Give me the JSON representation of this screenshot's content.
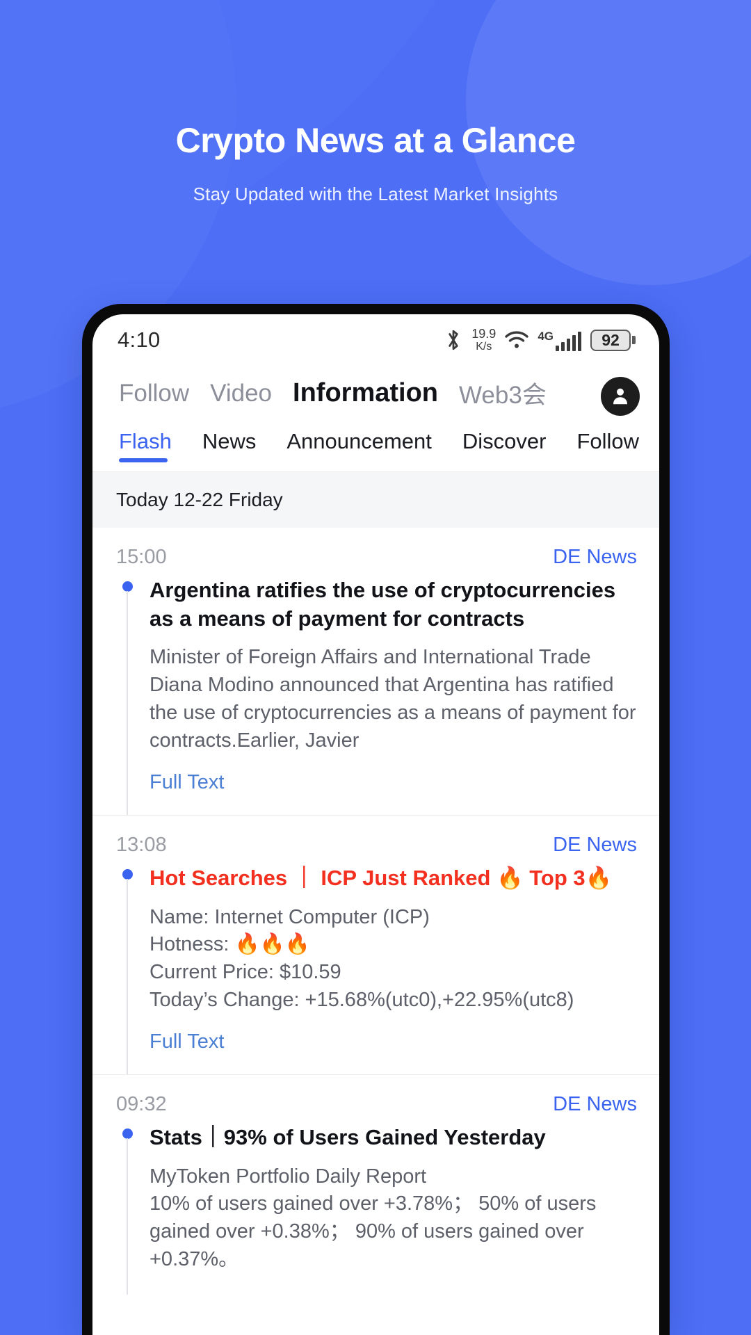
{
  "hero": {
    "title": "Crypto News at a Glance",
    "subtitle": "Stay Updated with the Latest Market Insights"
  },
  "colors": {
    "background": "#4d6ef5",
    "accent": "#3a63f0",
    "hot": "#f3301f",
    "link": "#4a7fd4"
  },
  "status_bar": {
    "time": "4:10",
    "net_speed_value": "19.9",
    "net_speed_unit": "K/s",
    "network_type": "4G",
    "battery_level": "92"
  },
  "top_nav": {
    "items": [
      {
        "label": "Follow",
        "active": false
      },
      {
        "label": "Video",
        "active": false
      },
      {
        "label": "Information",
        "active": true
      },
      {
        "label": "Web3会",
        "active": false
      }
    ]
  },
  "sub_tabs": {
    "items": [
      {
        "label": "Flash",
        "active": true
      },
      {
        "label": "News",
        "active": false
      },
      {
        "label": "Announcement",
        "active": false
      },
      {
        "label": "Discover",
        "active": false
      },
      {
        "label": "Follow",
        "active": false
      }
    ]
  },
  "date_header": "Today 12-22 Friday",
  "feed": {
    "full_text_label": "Full Text",
    "items": [
      {
        "time": "15:00",
        "source": "DE News",
        "title": "Argentina ratifies the use of cryptocurrencies as a means of payment for contracts",
        "hot": false,
        "body": "Minister of Foreign Affairs and International Trade Diana Modino announced that Argentina has ratified the use of cryptocurrencies as a means of payment for contracts.Earlier, Javier"
      },
      {
        "time": "13:08",
        "source": "DE News",
        "title": "Hot Searches ｜ ICP Just Ranked 🔥 Top 3🔥",
        "hot": true,
        "body": "Name: Internet Computer (ICP)\nHotness: 🔥🔥🔥\nCurrent Price: $10.59\nToday’s Change: +15.68%(utc0),+22.95%(utc8)"
      },
      {
        "time": "09:32",
        "source": "DE News",
        "title": "Stats｜93% of Users Gained Yesterday",
        "hot": false,
        "body": "MyToken Portfolio Daily Report\n10% of users gained over +3.78%； 50% of users gained over +0.38%； 90% of users gained over +0.37%。"
      }
    ]
  }
}
